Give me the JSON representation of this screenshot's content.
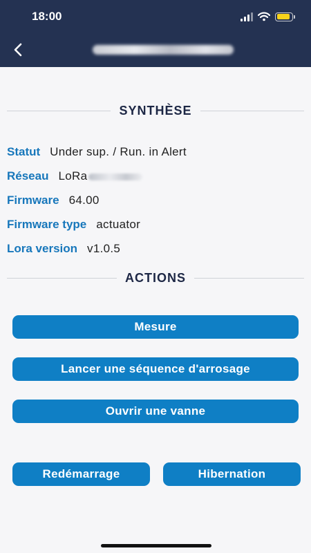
{
  "status_bar": {
    "time": "18:00",
    "wifi_icon": "wifi-icon",
    "battery_level": 0.9,
    "battery_color": "#f7d21b"
  },
  "header": {
    "back_icon": "chevron-left-icon",
    "background": "#243252"
  },
  "synthese": {
    "title": "SYNTHÈSE",
    "rows": [
      {
        "label": "Statut",
        "value": "Under sup. / Run. in Alert"
      },
      {
        "label": "Réseau",
        "value": "LoRa"
      },
      {
        "label": "Firmware",
        "value": "64.00"
      },
      {
        "label": "Firmware type",
        "value": "actuator"
      },
      {
        "label": "Lora version",
        "value": "v1.0.5"
      }
    ]
  },
  "actions": {
    "title": "ACTIONS",
    "mesure": "Mesure",
    "sequence": "Lancer une séquence d'arrosage",
    "vanne": "Ouvrir une vanne",
    "redemarrage": "Redémarrage",
    "hibernation": "Hibernation"
  },
  "colors": {
    "accent": "#1777bb",
    "button": "#0f7fc5",
    "heading": "#1d2745"
  }
}
